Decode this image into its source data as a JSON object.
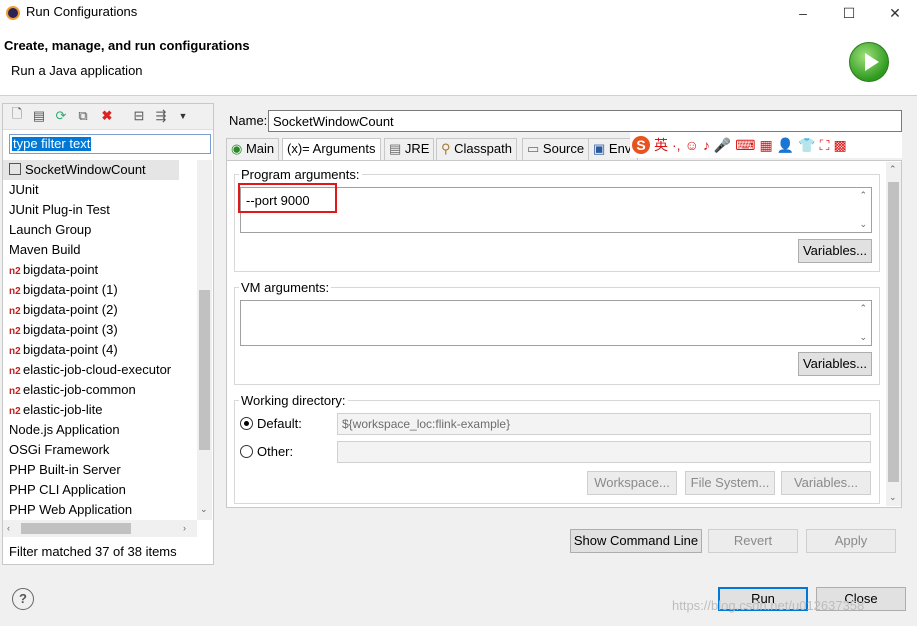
{
  "window": {
    "title": "Run Configurations",
    "controls": [
      "–",
      "☐",
      "✕"
    ]
  },
  "header": {
    "title": "Create, manage, and run configurations",
    "subtitle": "Run a Java application"
  },
  "left_panel": {
    "filter_placeholder": "type filter text",
    "items": [
      {
        "label": "SocketWindowCount",
        "prefix": ""
      },
      {
        "label": "JUnit",
        "prefix": ""
      },
      {
        "label": "JUnit Plug-in Test",
        "prefix": ""
      },
      {
        "label": "Launch Group",
        "prefix": ""
      },
      {
        "label": "Maven Build",
        "prefix": ""
      },
      {
        "label": "bigdata-point",
        "prefix": "n2"
      },
      {
        "label": "bigdata-point (1)",
        "prefix": "n2"
      },
      {
        "label": "bigdata-point (2)",
        "prefix": "n2"
      },
      {
        "label": "bigdata-point (3)",
        "prefix": "n2"
      },
      {
        "label": "bigdata-point (4)",
        "prefix": "n2"
      },
      {
        "label": "elastic-job-cloud-executor",
        "prefix": "n2"
      },
      {
        "label": "elastic-job-common",
        "prefix": "n2"
      },
      {
        "label": "elastic-job-lite",
        "prefix": "n2"
      },
      {
        "label": "Node.js Application",
        "prefix": ""
      },
      {
        "label": "OSGi Framework",
        "prefix": ""
      },
      {
        "label": "PHP Built-in Server",
        "prefix": ""
      },
      {
        "label": "PHP CLI Application",
        "prefix": ""
      },
      {
        "label": "PHP Web Application",
        "prefix": ""
      }
    ],
    "status": "Filter matched 37 of 38 items"
  },
  "config": {
    "name_label": "Name:",
    "name_value": "SocketWindowCount",
    "tabs": [
      "Main",
      "(x)= Arguments",
      "JRE",
      "Classpath",
      "Source",
      "Envi"
    ],
    "program_args_label": "Program arguments:",
    "program_args_value": "--port 9000",
    "vm_args_label": "VM arguments:",
    "vm_args_value": "",
    "variables_label": "Variables...",
    "working_dir_label": "Working directory:",
    "default_label": "Default:",
    "default_value": "${workspace_loc:flink-example}",
    "other_label": "Other:",
    "workspace_btn": "Workspace...",
    "filesystem_btn": "File System...",
    "variables_btn": "Variables..."
  },
  "footer": {
    "show_cmd": "Show Command Line",
    "revert": "Revert",
    "apply": "Apply",
    "run": "Run",
    "close": "Close",
    "watermark": "https://blog.csdn.net/u012637358"
  },
  "ime": [
    "S",
    "英",
    "·,",
    "☺",
    "♪",
    "🎤",
    "⌨",
    "▦",
    "👤",
    "👕",
    "⛶",
    "▩"
  ]
}
